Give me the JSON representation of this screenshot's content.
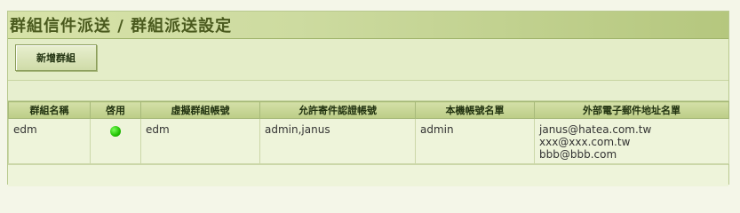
{
  "page": {
    "title": "群組信件派送 / 群組派送設定",
    "add_group_label": "新增群組"
  },
  "table": {
    "headers": [
      "群組名稱",
      "啓用",
      "虛擬群組帳號",
      "允許寄件認證帳號",
      "本機帳號名單",
      "外部電子郵件地址名單"
    ],
    "rows": [
      {
        "group_name": "edm",
        "enabled": true,
        "virtual_account": "edm",
        "allowed_senders": "admin,janus",
        "local_accounts": "admin",
        "external_emails": [
          "janus@hatea.com.tw",
          "xxx@xxx.com.tw",
          "bbb@bbb.com"
        ]
      }
    ]
  },
  "colors": {
    "enabled_indicator": "#20c000",
    "title_text": "#4a5a1e"
  }
}
